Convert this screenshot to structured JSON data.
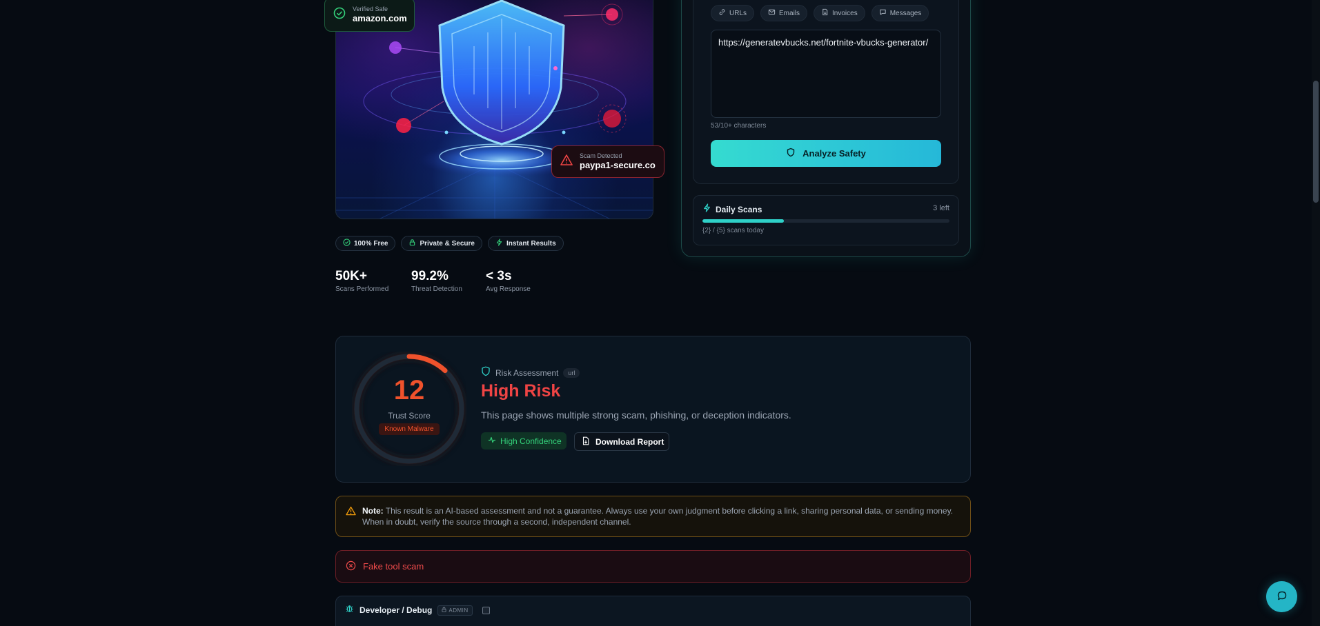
{
  "hero": {
    "safe_card": {
      "label": "Verified Safe",
      "domain": "amazon.com"
    },
    "scam_card": {
      "label": "Scam Detected",
      "domain": "paypa1-secure.co"
    },
    "pills": [
      "100% Free",
      "Private & Secure",
      "Instant Results"
    ],
    "stats": [
      {
        "value": "50K+",
        "label": "Scans Performed"
      },
      {
        "value": "99.2%",
        "label": "Threat Detection"
      },
      {
        "value": "< 3s",
        "label": "Avg Response"
      }
    ]
  },
  "scanner": {
    "tabs": [
      "URLs",
      "Emails",
      "Invoices",
      "Messages"
    ],
    "input_value": "https://generatevbucks.net/fortnite-vbucks-generator/",
    "char_count": "53/10+ characters",
    "analyze_label": "Analyze Safety",
    "daily": {
      "title": "Daily Scans",
      "remaining": "3 left",
      "detail": "{2} / {5} scans today",
      "progress_fraction": 0.33
    }
  },
  "risk": {
    "score": "12",
    "score_label": "Trust Score",
    "badge": "Known Malware",
    "section_label": "Risk Assessment",
    "type_tag": "url",
    "title": "High Risk",
    "description": "This page shows multiple strong scam, phishing, or deception indicators.",
    "confidence": "High Confidence",
    "download_label": "Download Report",
    "score_fraction": 0.12
  },
  "note": {
    "label": "Note:",
    "text": "This result is an AI-based assessment and not a guarantee. Always use your own judgment before clicking a link, sharing personal data, or sending money. When in doubt, verify the source through a second, independent channel."
  },
  "alert": {
    "text": "Fake tool scam"
  },
  "debug": {
    "title": "Developer / Debug",
    "badge": "ADMIN"
  },
  "colors": {
    "accent": "#2fd1c8",
    "danger": "#ef4444",
    "risk_orange": "#f0522c",
    "success": "#34d27b",
    "warning": "#f59e0b"
  },
  "icons": {
    "safe": "check-circle-icon",
    "scam": "warning-triangle-icon",
    "url_tab": "link-icon",
    "email_tab": "mail-icon",
    "invoice_tab": "file-icon",
    "message_tab": "chat-icon",
    "analyze": "shield-icon",
    "daily": "bolt-icon",
    "chat": "chat-bubble-icon"
  }
}
